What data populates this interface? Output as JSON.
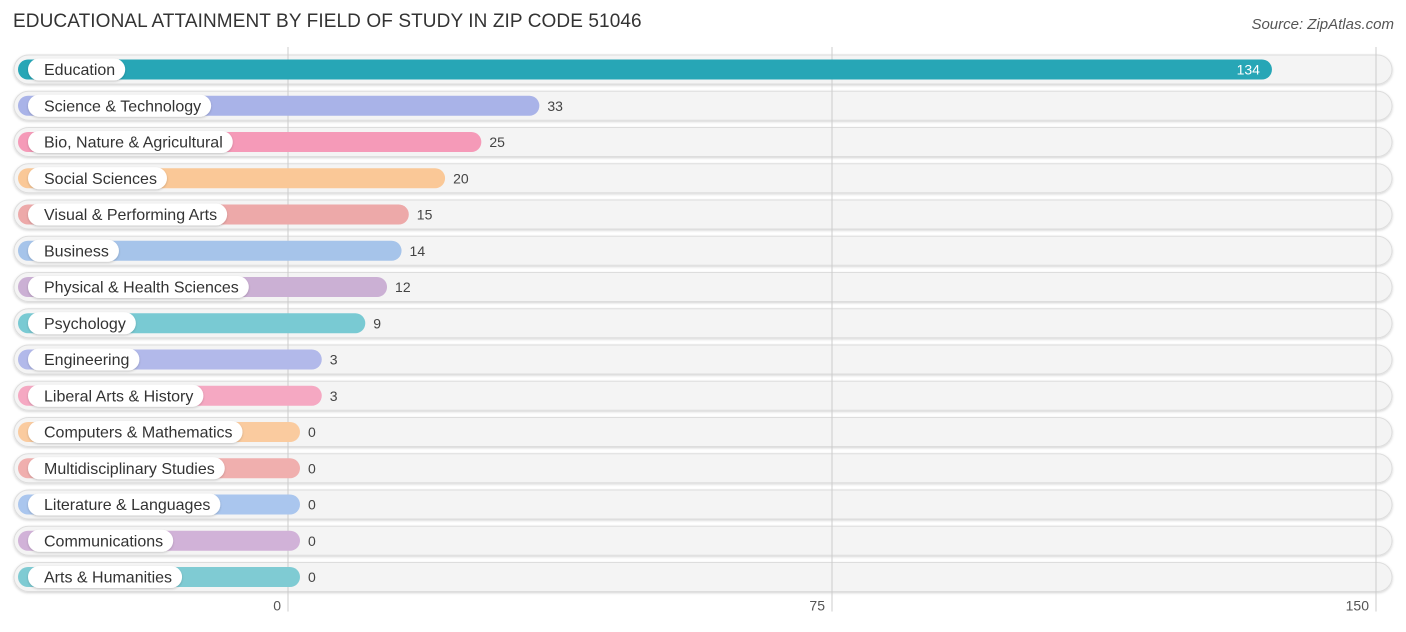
{
  "header": {
    "title": "EDUCATIONAL ATTAINMENT BY FIELD OF STUDY IN ZIP CODE 51046",
    "source": "Source: ZipAtlas.com"
  },
  "chart_data": {
    "type": "bar",
    "orientation": "horizontal",
    "title": "EDUCATIONAL ATTAINMENT BY FIELD OF STUDY IN ZIP CODE 51046",
    "xlabel": "",
    "ylabel": "",
    "xlim": [
      0,
      150
    ],
    "ticks": [
      0,
      75,
      150
    ],
    "tick_labels": [
      "0",
      "75",
      "150"
    ],
    "grid": true,
    "categories": [
      "Education",
      "Science & Technology",
      "Bio, Nature & Agricultural",
      "Social Sciences",
      "Visual & Performing Arts",
      "Business",
      "Physical & Health Sciences",
      "Psychology",
      "Engineering",
      "Liberal Arts & History",
      "Computers & Mathematics",
      "Multidisciplinary Studies",
      "Literature & Languages",
      "Communications",
      "Arts & Humanities"
    ],
    "values": [
      134,
      33,
      25,
      20,
      15,
      14,
      12,
      9,
      3,
      3,
      0,
      0,
      0,
      0,
      0
    ],
    "value_labels": [
      "134",
      "33",
      "25",
      "20",
      "15",
      "14",
      "12",
      "9",
      "3",
      "3",
      "0",
      "0",
      "0",
      "0",
      "0"
    ],
    "colors": [
      "#27a6b6",
      "#a9b3e8",
      "#f59ab8",
      "#fac897",
      "#eda9a9",
      "#a6c4ea",
      "#cbb0d4",
      "#79cad3",
      "#b2b9ea",
      "#f5a8c2",
      "#facb9f",
      "#f0afae",
      "#aac6ee",
      "#d1b2d8",
      "#7fcbd3"
    ]
  }
}
